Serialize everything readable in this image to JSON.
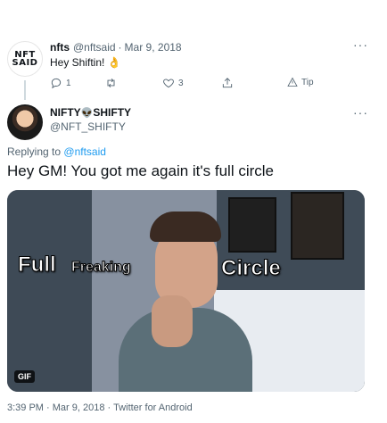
{
  "parent_tweet": {
    "avatar_text_line1": "NFT",
    "avatar_text_line2": "SAID",
    "display_name": "nfts",
    "handle": "@nftsaid",
    "separator": "·",
    "date": "Mar 9, 2018",
    "text": "Hey Shiftin!",
    "emoji": "👌",
    "more_label": "···",
    "actions": {
      "reply_count": "1",
      "retweet_count": "",
      "like_count": "3",
      "share_count": "",
      "tip_label": "Tip"
    }
  },
  "reply_tweet": {
    "display_name_part1": "NIFTY",
    "display_name_emoji": "👽",
    "display_name_part2": "SHIFTY",
    "handle": "@NFT_SHIFTY",
    "more_label": "···",
    "replying_to_prefix": "Replying to",
    "replying_to_handle": "@nftsaid",
    "text": "Hey GM! You got me again it's full circle",
    "gif": {
      "caption_full": "Full",
      "caption_freaking": "Freaking",
      "caption_circle": "Circle",
      "badge": "GIF"
    },
    "footer": {
      "time": "3:39 PM",
      "separator": "·",
      "date": "Mar 9, 2018",
      "separator2": "·",
      "client": "Twitter for Android"
    }
  },
  "colors": {
    "link": "#1d9bf0",
    "muted": "#536471",
    "thread_line": "#cfd9de"
  },
  "icons": [
    "reply-icon",
    "retweet-icon",
    "like-icon",
    "share-icon",
    "tip-icon",
    "more-icon"
  ]
}
